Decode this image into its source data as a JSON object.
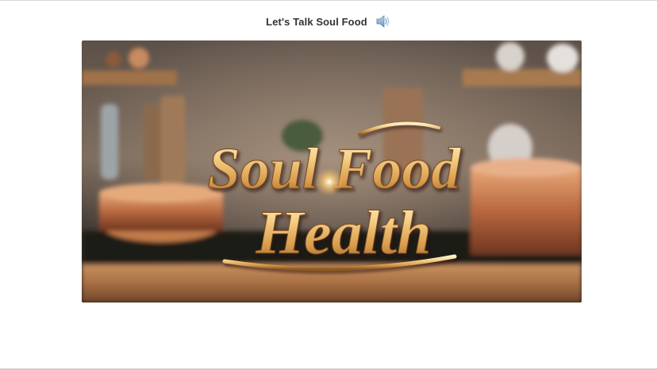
{
  "header": {
    "title": "Let's Talk Soul Food",
    "audio_icon": "speaker-volume-icon"
  },
  "media": {
    "logo_line1": "Soul Food",
    "logo_line2": "Health",
    "description_icon": "kitchen-background-image"
  },
  "colors": {
    "title_text": "#333333",
    "speaker_icon": "#8fb2d6",
    "logo_gold": "#f0c77e"
  }
}
